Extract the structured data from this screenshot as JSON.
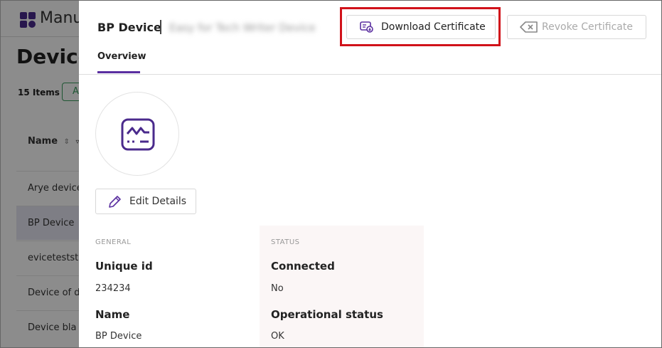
{
  "background": {
    "brand": "Manu",
    "page_title": "Device",
    "count": "15 Items",
    "add_label": "A",
    "column_name": "Name",
    "rows": [
      "Arye device",
      "BP Device",
      "eviceteststa",
      "Device of d",
      "Device bla"
    ]
  },
  "drawer": {
    "title": "BP Device",
    "subtitle": "Easy for Tech Writer Device",
    "download_label": "Download Certificate",
    "revoke_label": "Revoke Certificate",
    "tab_overview": "Overview",
    "edit_label": "Edit Details",
    "general_heading": "GENERAL",
    "status_heading": "STATUS",
    "fields": {
      "unique_id_label": "Unique id",
      "unique_id_value": "234234",
      "name_label": "Name",
      "name_value": "BP Device",
      "connected_label": "Connected",
      "connected_value": "No",
      "operational_label": "Operational status",
      "operational_value": "OK"
    }
  },
  "colors": {
    "accent": "#5a2fa0",
    "highlight": "#d1121a",
    "disabled_text": "#aaaaaa"
  },
  "icons": [
    "certificate-icon",
    "backspace-x-icon",
    "device-monitor-icon",
    "pencil-icon",
    "sort-icon",
    "filter-icon"
  ]
}
